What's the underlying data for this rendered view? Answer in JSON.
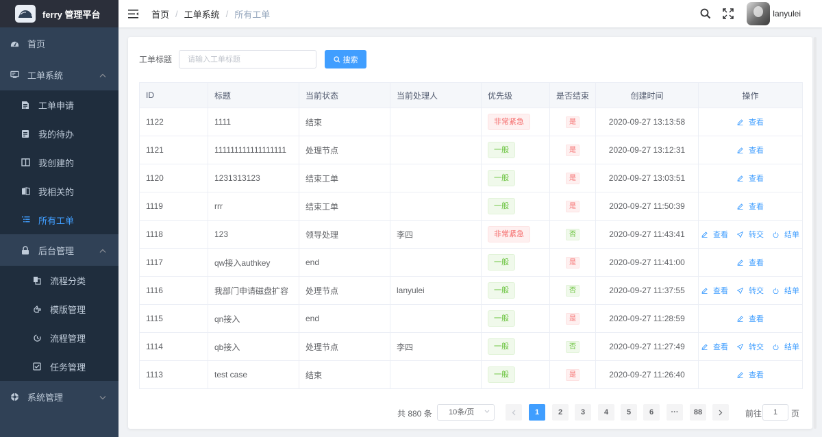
{
  "app": {
    "title": "ferry 管理平台"
  },
  "sidebar": {
    "home": "首页",
    "ticket_system": {
      "label": "工单系统",
      "items": [
        {
          "label": "工单申请",
          "icon": "form-icon"
        },
        {
          "label": "我的待办",
          "icon": "todo-icon"
        },
        {
          "label": "我创建的",
          "icon": "book-icon"
        },
        {
          "label": "我相关的",
          "icon": "read-icon"
        },
        {
          "label": "所有工单",
          "icon": "list-icon",
          "active": true
        }
      ]
    },
    "admin": {
      "label": "后台管理",
      "items": [
        {
          "label": "流程分类",
          "icon": "category-icon"
        },
        {
          "label": "模版管理",
          "icon": "template-icon"
        },
        {
          "label": "流程管理",
          "icon": "process-icon"
        },
        {
          "label": "任务管理",
          "icon": "task-icon"
        }
      ]
    },
    "system": "系统管理"
  },
  "breadcrumb": [
    "首页",
    "工单系统",
    "所有工单"
  ],
  "user": {
    "name": "lanyulei"
  },
  "search": {
    "label": "工单标题",
    "placeholder": "请输入工单标题",
    "button": "搜索"
  },
  "table": {
    "columns": [
      "ID",
      "标题",
      "当前状态",
      "当前处理人",
      "优先级",
      "是否结束",
      "创建时间",
      "操作"
    ],
    "rows": [
      {
        "id": "1122",
        "title": "1111",
        "status": "结束",
        "handler": "",
        "priority": "非常紧急",
        "priority_type": "danger",
        "ended": "是",
        "created": "2020-09-27 13:13:58",
        "ops": [
          "查看"
        ]
      },
      {
        "id": "1121",
        "title": "111111111111111111",
        "status": "处理节点",
        "handler": "",
        "priority": "一般",
        "priority_type": "success",
        "ended": "是",
        "created": "2020-09-27 13:12:31",
        "ops": [
          "查看"
        ]
      },
      {
        "id": "1120",
        "title": "1231313123",
        "status": "结束工单",
        "handler": "",
        "priority": "一般",
        "priority_type": "success",
        "ended": "是",
        "created": "2020-09-27 13:03:51",
        "ops": [
          "查看"
        ]
      },
      {
        "id": "1119",
        "title": "rrr",
        "status": "结束工单",
        "handler": "",
        "priority": "一般",
        "priority_type": "success",
        "ended": "是",
        "created": "2020-09-27 11:50:39",
        "ops": [
          "查看"
        ]
      },
      {
        "id": "1118",
        "title": "123",
        "status": "领导处理",
        "handler": "李四",
        "priority": "非常紧急",
        "priority_type": "danger",
        "ended": "否",
        "created": "2020-09-27 11:43:41",
        "ops": [
          "查看",
          "转交",
          "结单"
        ]
      },
      {
        "id": "1117",
        "title": "qw接入authkey",
        "status": "end",
        "handler": "",
        "priority": "一般",
        "priority_type": "success",
        "ended": "是",
        "created": "2020-09-27 11:41:00",
        "ops": [
          "查看"
        ]
      },
      {
        "id": "1116",
        "title": "我部门申请磁盘扩容",
        "status": "处理节点",
        "handler": "lanyulei",
        "priority": "一般",
        "priority_type": "success",
        "ended": "否",
        "created": "2020-09-27 11:37:55",
        "ops": [
          "查看",
          "转交",
          "结单"
        ]
      },
      {
        "id": "1115",
        "title": "qn接入",
        "status": "end",
        "handler": "",
        "priority": "一般",
        "priority_type": "success",
        "ended": "是",
        "created": "2020-09-27 11:28:59",
        "ops": [
          "查看"
        ]
      },
      {
        "id": "1114",
        "title": "qb接入",
        "status": "处理节点",
        "handler": "李四",
        "priority": "一般",
        "priority_type": "success",
        "ended": "否",
        "created": "2020-09-27 11:27:49",
        "ops": [
          "查看",
          "转交",
          "结单"
        ]
      },
      {
        "id": "1113",
        "title": "test case",
        "status": "结束",
        "handler": "",
        "priority": "一般",
        "priority_type": "success",
        "ended": "是",
        "created": "2020-09-27 11:26:40",
        "ops": [
          "查看"
        ]
      }
    ]
  },
  "pagination": {
    "total": "共 880 条",
    "page_size": "10条/页",
    "pages": [
      "1",
      "2",
      "3",
      "4",
      "5",
      "6",
      "···",
      "88"
    ],
    "current": "1",
    "goto_label": "前往",
    "goto_value": "1",
    "goto_unit": "页"
  },
  "colors": {
    "accent": "#409eff",
    "sidebar": "#304156",
    "danger": "#f56c6c",
    "success": "#67c23a"
  }
}
